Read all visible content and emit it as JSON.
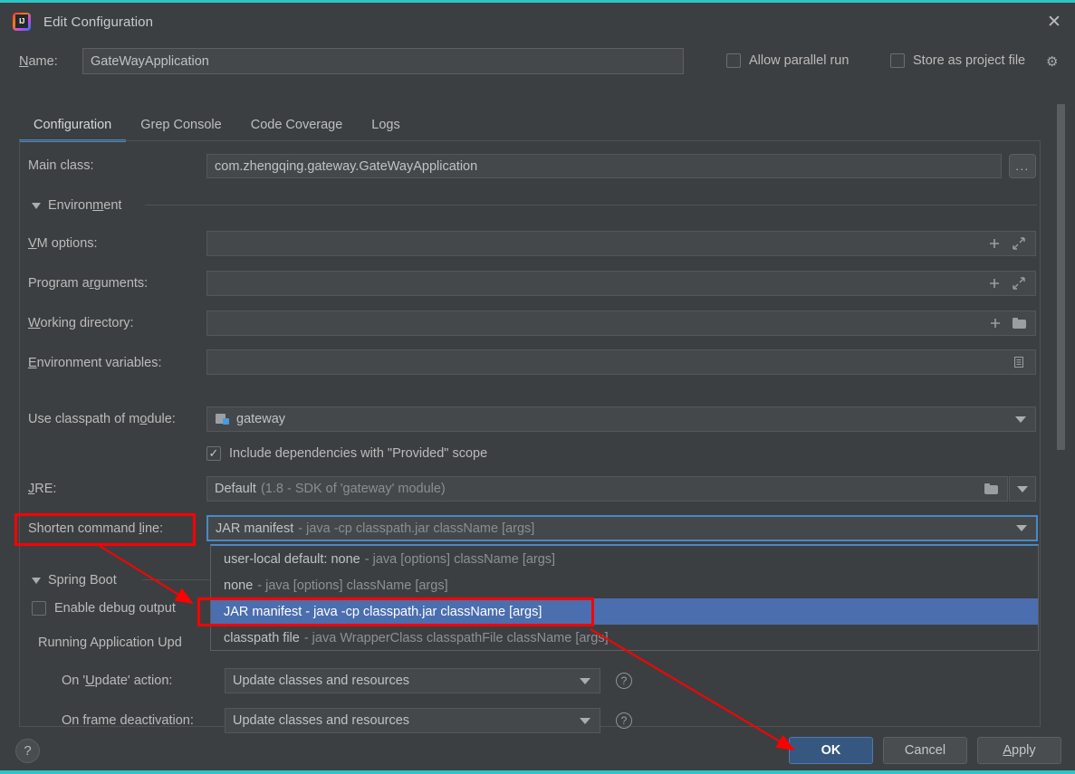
{
  "window": {
    "title": "Edit Configuration",
    "logo_icon": "intellij-idea-logo",
    "close_icon": "close-icon"
  },
  "name_row": {
    "label": "Name:",
    "value": "GateWayApplication",
    "allow_parallel_run": {
      "label": "Allow parallel run",
      "checked": false
    },
    "store_as_project_file": {
      "label": "Store as project file",
      "checked": false
    },
    "gear_icon": "gear-icon"
  },
  "tabs": [
    {
      "label": "Configuration",
      "active": true
    },
    {
      "label": "Grep Console",
      "active": false
    },
    {
      "label": "Code Coverage",
      "active": false
    },
    {
      "label": "Logs",
      "active": false
    }
  ],
  "form": {
    "main_class": {
      "label": "Main class:",
      "value": "com.zhengqing.gateway.GateWayApplication",
      "browse_label": "..."
    },
    "environment_section": {
      "label": "Environment",
      "expanded": true
    },
    "vm_options": {
      "label": "VM options:",
      "value": "",
      "icons": [
        "plus-icon",
        "expand-icon"
      ]
    },
    "program_arguments": {
      "label": "Program arguments:",
      "value": "",
      "icons": [
        "plus-icon",
        "expand-icon"
      ]
    },
    "working_directory": {
      "label": "Working directory:",
      "value": "",
      "icons": [
        "plus-icon",
        "folder-icon"
      ]
    },
    "environment_variables": {
      "label": "Environment variables:",
      "value": "",
      "icons": [
        "list-icon"
      ]
    },
    "use_classpath_of_module": {
      "label": "Use classpath of module:",
      "value": "gateway",
      "module_icon": "module-icon"
    },
    "include_provided": {
      "label": "Include dependencies with \"Provided\" scope",
      "checked": true
    },
    "jre": {
      "label": "JRE:",
      "value": "Default",
      "hint": "(1.8 - SDK of 'gateway' module)",
      "folder_icon": "folder-icon"
    },
    "shorten_command_line": {
      "label": "Shorten command line:",
      "value_bold": "JAR manifest",
      "value_dim": "- java -cp classpath.jar className [args]"
    }
  },
  "dropdown": {
    "items": [
      {
        "bold": "user-local default: none",
        "dim": "- java [options] className [args]",
        "selected": false
      },
      {
        "bold": "none",
        "dim": "- java [options] className [args]",
        "selected": false
      },
      {
        "bold": "JAR manifest - java -cp classpath.jar className [args]",
        "dim": "",
        "selected": true
      },
      {
        "bold": "classpath file",
        "dim": "- java WrapperClass classpathFile className [args]",
        "selected": false
      }
    ]
  },
  "spring_boot": {
    "section_label": "Spring Boot",
    "enable_debug_output": {
      "label": "Enable debug output",
      "checked": false
    },
    "running_app_update_policies": "Running Application Upd",
    "on_update_action": {
      "label": "On 'Update' action:",
      "value": "Update classes and resources",
      "help_icon": "help-icon"
    },
    "on_frame_deactivation": {
      "label": "On frame deactivation:",
      "value": "Update classes and resources",
      "help_icon": "help-icon"
    }
  },
  "footer": {
    "help_label": "?",
    "ok_label": "OK",
    "cancel_label": "Cancel",
    "apply_label": "Apply"
  },
  "annotations": {
    "highlight_color": "#ff0000",
    "boxes": [
      {
        "name": "shorten-command-line-label-highlight"
      },
      {
        "name": "jar-manifest-option-highlight"
      }
    ],
    "arrows": [
      {
        "name": "arrow-label-to-option"
      },
      {
        "name": "arrow-option-to-ok"
      }
    ]
  },
  "colors": {
    "background": "#3c3f41",
    "accent_tab": "#4a88c7",
    "selection_blue": "#4b6eaf",
    "ok_button": "#365880",
    "window_border_teal": "#2ec4c4"
  }
}
